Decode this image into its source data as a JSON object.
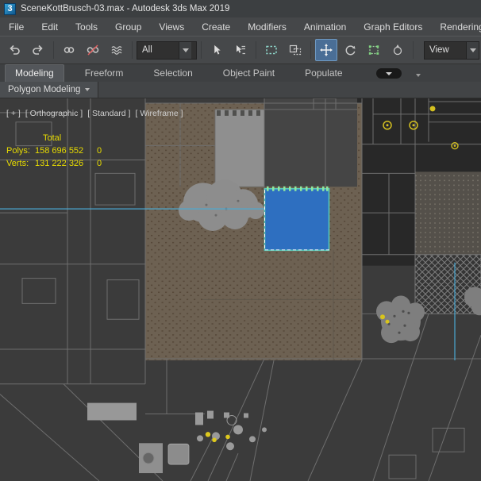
{
  "window": {
    "title": "SceneKottBrusch-03.max - Autodesk 3ds Max 2019",
    "app_icon_text": "3"
  },
  "menu": {
    "items": [
      "File",
      "Edit",
      "Tools",
      "Group",
      "Views",
      "Create",
      "Modifiers",
      "Animation",
      "Graph Editors",
      "Rendering"
    ]
  },
  "toolbar": {
    "selection_filter_value": "All",
    "coord_system_value": "View",
    "icons": [
      "undo",
      "redo",
      "select-and-link",
      "unlink-selection",
      "bind-to-space-warp",
      "select-object",
      "select-by-name",
      "rectangular-selection-region",
      "window-crossing",
      "select-and-move",
      "select-and-rotate",
      "select-and-scale",
      "select-and-place"
    ]
  },
  "ribbon": {
    "tabs": [
      "Modeling",
      "Freeform",
      "Selection",
      "Object Paint",
      "Populate"
    ],
    "active_tab": "Modeling",
    "subtab": "Polygon Modeling"
  },
  "viewport": {
    "label": {
      "expand": "[ + ]",
      "pov": "[ Orthographic ]",
      "standard": "[ Standard ]",
      "shading": "[ Wireframe ]"
    },
    "stats": {
      "header": "Total",
      "rows": [
        {
          "label": "Polys:",
          "value": "158 696 552",
          "selected": "0"
        },
        {
          "label": "Verts:",
          "value": "131 222 326",
          "selected": "0"
        }
      ]
    },
    "colors": {
      "selected_fill": "#2e6fc0",
      "selection_outline": "#57c8b8",
      "link_line": "#4aaad4",
      "stats_text": "#e8dc00",
      "terrain": "#6d6152",
      "light_icon": "#d4c020"
    }
  }
}
